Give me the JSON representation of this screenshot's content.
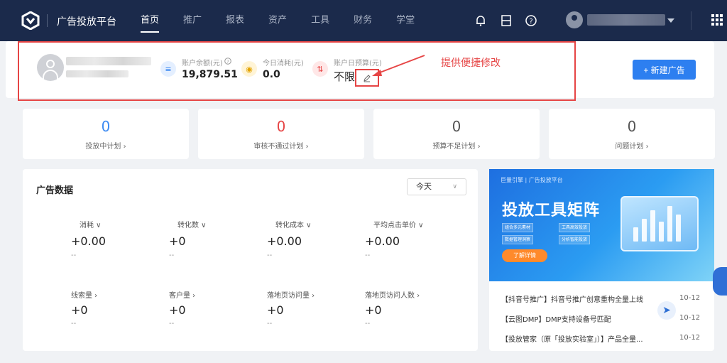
{
  "header": {
    "brand": "广告投放平台",
    "nav": [
      {
        "label": "首页",
        "active": true
      },
      {
        "label": "推广",
        "active": false
      },
      {
        "label": "报表",
        "active": false
      },
      {
        "label": "资产",
        "active": false
      },
      {
        "label": "工具",
        "active": false
      },
      {
        "label": "财务",
        "active": false
      },
      {
        "label": "学堂",
        "active": false
      }
    ],
    "icons": [
      "bell-icon",
      "book-icon",
      "help-icon",
      "user-avatar",
      "apps-grid-icon"
    ]
  },
  "account": {
    "balance_label": "账户余额(元)",
    "balance_value": "19,879.51",
    "today_cost_label": "今日消耗(元)",
    "today_cost_value": "0.0",
    "daily_budget_label": "账户日预算(元)",
    "daily_budget_value": "不限",
    "annotation": "提供便捷修改",
    "new_ad_button": "+ 新建广告"
  },
  "plans": [
    {
      "value": "0",
      "label": "投放中计划",
      "color": "#3d8bf2"
    },
    {
      "value": "0",
      "label": "审核不通过计划",
      "color": "#e64545"
    },
    {
      "value": "0",
      "label": "预算不足计划",
      "color": "#555555"
    },
    {
      "value": "0",
      "label": "问题计划",
      "color": "#555555"
    }
  ],
  "ad_data": {
    "title": "广告数据",
    "period": "今天",
    "metrics_row1": [
      {
        "label": "消耗",
        "value": "+0.00",
        "compare": "--"
      },
      {
        "label": "转化数",
        "value": "+0",
        "compare": "--"
      },
      {
        "label": "转化成本",
        "value": "+0.00",
        "compare": "--"
      },
      {
        "label": "平均点击单价",
        "value": "+0.00",
        "compare": "--"
      }
    ],
    "metrics_row2": [
      {
        "label": "线索量",
        "value": "+0",
        "compare": "--"
      },
      {
        "label": "客户量",
        "value": "+0",
        "compare": "--"
      },
      {
        "label": "落地页访问量",
        "value": "+0",
        "compare": "--"
      },
      {
        "label": "落地页访问人数",
        "value": "+0",
        "compare": "--"
      }
    ]
  },
  "banner": {
    "brand": "巨量引擎 | 广告投放平台",
    "title": "投放工具矩阵",
    "tags": [
      "组合多元素材",
      "工具高效投放",
      "数据管理洞察",
      "分析智能投放"
    ],
    "button": "了解详情"
  },
  "news": [
    {
      "text": "【抖音号推广】抖音号推广创意重构全量上线",
      "date": "10-12"
    },
    {
      "text": "【云图DMP】DMP支持设备号匹配",
      "date": "10-12"
    },
    {
      "text": "【投放管家（原「投放实验室」）】产品全量...",
      "date": "10-12"
    }
  ],
  "colors": {
    "nav_bg": "#1b2a4b",
    "primary": "#2d7ff0",
    "annotation_red": "#e64545"
  }
}
